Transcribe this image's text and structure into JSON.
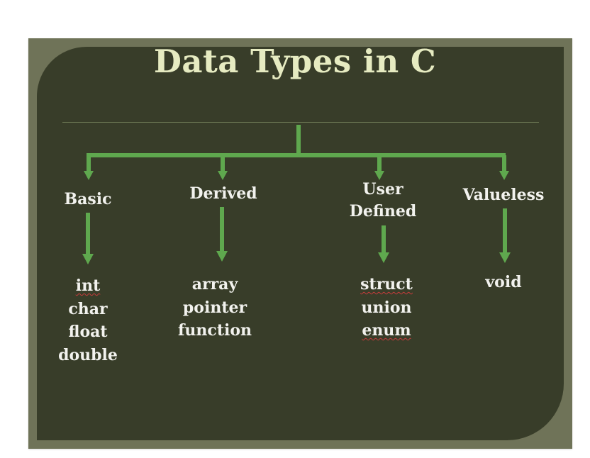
{
  "title": "Data Types in C",
  "colors": {
    "panel": "#383d29",
    "frame": "#6f7358",
    "title": "#e6ebc1",
    "text": "#f2f2ee",
    "connector": "#5fa84e",
    "spellcheck": "#c43b3b"
  },
  "categories": [
    {
      "name": "Basic",
      "items": [
        "int",
        "char",
        "float",
        "double"
      ]
    },
    {
      "name": "Derived",
      "items": [
        "array",
        "pointer",
        "function"
      ]
    },
    {
      "name": "User\nDefined",
      "items": [
        "struct",
        "union",
        "enum"
      ]
    },
    {
      "name": "Valueless",
      "items": [
        "void"
      ]
    }
  ],
  "spellcheck_flagged": [
    "int",
    "struct",
    "enum"
  ]
}
